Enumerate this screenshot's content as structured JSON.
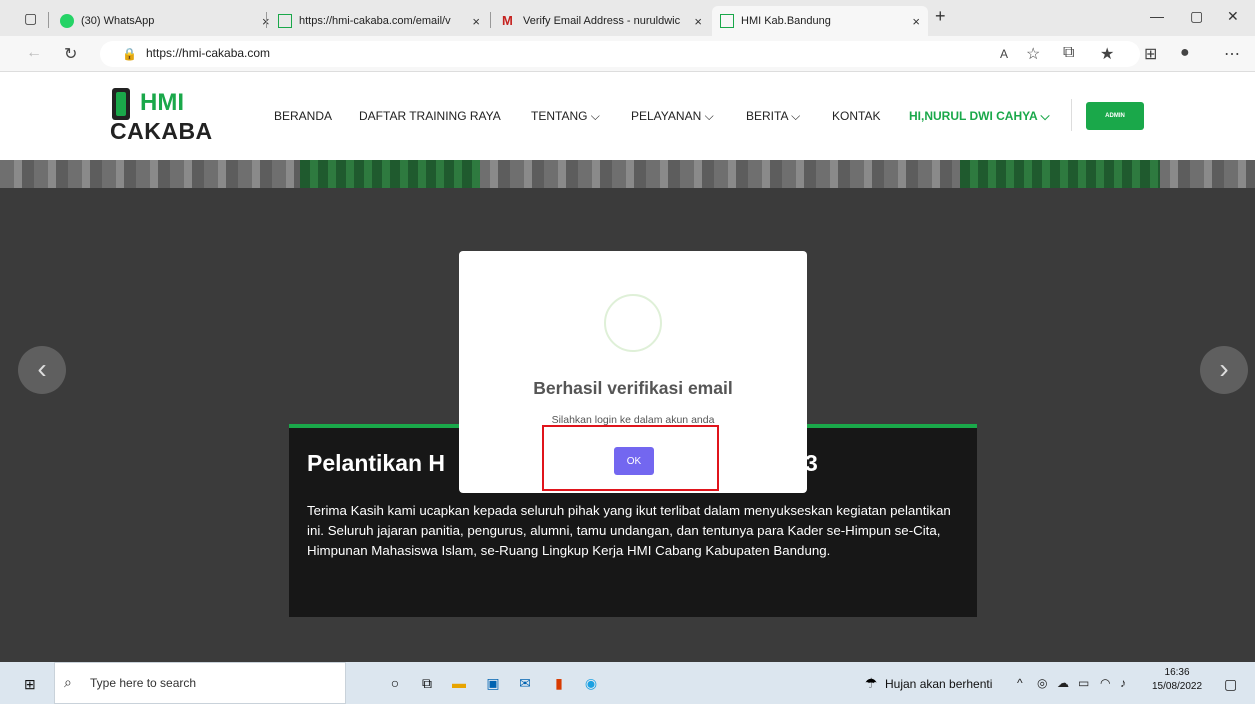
{
  "browser": {
    "tabs": [
      {
        "label": "(30) WhatsApp"
      },
      {
        "label": "https://hmi-cakaba.com/email/v"
      },
      {
        "label": "Verify Email Address - nuruldwic"
      },
      {
        "label": "HMI Kab.Bandung"
      }
    ],
    "new_tab": "+",
    "close": "×",
    "url": "https://hmi-cakaba.com",
    "window_minimize": "—",
    "window_restore": "▢",
    "window_close": "✕"
  },
  "site": {
    "logo_top": "HMI",
    "logo_bottom": "CAKABA",
    "nav": [
      "BERANDA",
      "DAFTAR TRAINING RAYA",
      "TENTANG ⌵",
      "PELAYANAN ⌵",
      "BERITA ⌵",
      "KONTAK"
    ],
    "user": "HI,NURUL DWI CAHYA ⌵",
    "admin_button": "ADMIN"
  },
  "hero": {
    "title_left": "Pelantikan H",
    "title_right": "3",
    "body": "Terima Kasih kami ucapkan kepada seluruh pihak yang ikut terlibat dalam menyukseskan kegiatan pelantikan ini. Seluruh jajaran panitia, pengurus, alumni, tamu undangan, dan tentunya para Kader se-Himpun se-Cita, Himpunan Mahasiswa Islam, se-Ruang Lingkup Kerja HMI Cabang Kabupaten Bandung.",
    "prev": "‹",
    "next": "›"
  },
  "modal": {
    "title": "Berhasil verifikasi email",
    "text": "Silahkan login ke dalam akun anda",
    "ok_label": "OK"
  },
  "taskbar": {
    "search_placeholder": "Type here to search",
    "weather": "Hujan akan berhenti",
    "time": "16:36",
    "date": "15/08/2022"
  }
}
